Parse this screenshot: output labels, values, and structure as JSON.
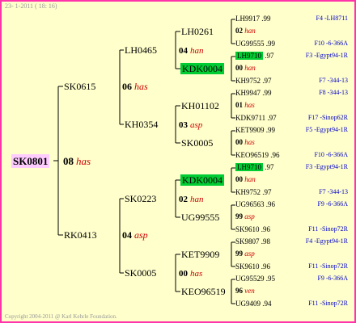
{
  "header": "23- 1-2011 ( 18: 16)",
  "copyright": "Copyright 2004-2011 @ Karl Kehrle Foundation.",
  "root": {
    "id": "SK0801",
    "num": "08",
    "apiary": "has"
  },
  "gen2": [
    {
      "id": "SK0615",
      "num": "06",
      "apiary": "has"
    },
    {
      "id": "RK0413",
      "num": "04",
      "apiary": "asp"
    }
  ],
  "gen3": [
    {
      "id": "LH0465"
    },
    {
      "id": "KH0354"
    },
    {
      "id": "SK0223"
    },
    {
      "id": "SK0005"
    }
  ],
  "gen3_nums": [
    {
      "num": "02",
      "apiary": "han"
    },
    {
      "num": "00",
      "apiary": "has"
    }
  ],
  "gen4": [
    {
      "id": "LH0261",
      "num": "04",
      "apiary": "han"
    },
    {
      "id": "KDK0004"
    },
    {
      "id": "KH01102",
      "num": "03",
      "apiary": "asp"
    },
    {
      "id": "SK0005"
    },
    {
      "id": "KDK0004",
      "num": "02",
      "apiary": "han"
    },
    {
      "id": "UG99555"
    },
    {
      "id": "KET9909",
      "num": "00",
      "apiary": "has"
    },
    {
      "id": "KEO96519",
      "num": "96",
      "apiary": "ven"
    }
  ],
  "gen5": [
    {
      "id": "LH9917",
      "year": ".99",
      "sub": "F4 -LH8711"
    },
    {
      "num": "02",
      "apiary": "han"
    },
    {
      "id": "UG99555",
      "year": ".99",
      "sub": "F10 -6-366A"
    },
    {
      "id": "LH9710",
      "year": ".97",
      "sub": "F3 -Egypt94-1R"
    },
    {
      "num": "00",
      "apiary": "han"
    },
    {
      "id": "KH9752",
      "year": ".97",
      "sub": "F7 -344-13"
    },
    {
      "id": "KH9947",
      "year": ".99",
      "sub": "F8 -344-13"
    },
    {
      "num": "01",
      "apiary": "has"
    },
    {
      "id": "KDK9711",
      "year": ".97",
      "sub": "F17 -Sinop62R"
    },
    {
      "id": "KET9909",
      "year": ".99",
      "sub": "F5 -Egypt94-1R"
    },
    {
      "num": "00",
      "apiary": "has"
    },
    {
      "id": "KEO96519",
      "year": ".96",
      "sub": "F10 -6-366A"
    },
    {
      "id": "LH9710",
      "year": ".97",
      "sub": "F3 -Egypt94-1R"
    },
    {
      "num": "00",
      "apiary": "han"
    },
    {
      "id": "KH9752",
      "year": ".97",
      "sub": "F7 -344-13"
    },
    {
      "id": "UG96563",
      "year": ".96",
      "sub": "F9 -6-366A"
    },
    {
      "num": "99",
      "apiary": "asp"
    },
    {
      "id": "SK9610",
      "year": ".96",
      "sub": "F11 -Sinop72R"
    },
    {
      "id": "SK9807",
      "year": ".98",
      "sub": "F4 -Egypt94-1R"
    },
    {
      "num": "99",
      "apiary": "asp"
    },
    {
      "id": "SK9610",
      "year": ".96",
      "sub": "F11 -Sinop72R"
    },
    {
      "id": "UG95529",
      "year": ".95",
      "sub": "F9 -6-366A"
    },
    {
      "num": "96",
      "apiary": "ven"
    },
    {
      "id": "UG9409",
      "year": ".94",
      "sub": "F11 -Sinop72R"
    }
  ],
  "colors": {
    "frame": "#ff33aa",
    "background": "#ffffcc",
    "highlight_green": "#00cc33",
    "apiary_red": "#cc0000",
    "sub_blue": "#0000cc",
    "root_pink": "#ffccff"
  }
}
